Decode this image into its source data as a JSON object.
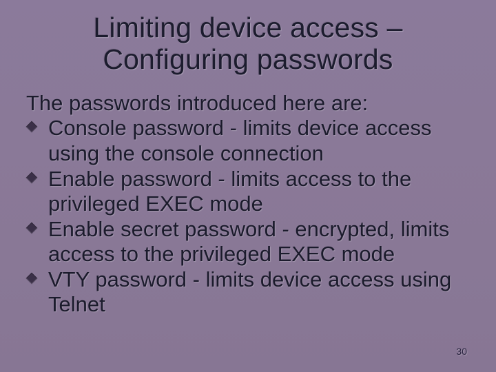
{
  "slide": {
    "title_line1": "Limiting device access –",
    "title_line2": "Configuring passwords",
    "intro": "The passwords introduced here are:",
    "bullets": [
      "Console password - limits device access using the console connection",
      "Enable password - limits access to the privileged EXEC mode",
      "Enable secret password - encrypted, limits access to the privileged EXEC mode",
      "VTY password - limits device access using Telnet"
    ],
    "number": "30"
  }
}
